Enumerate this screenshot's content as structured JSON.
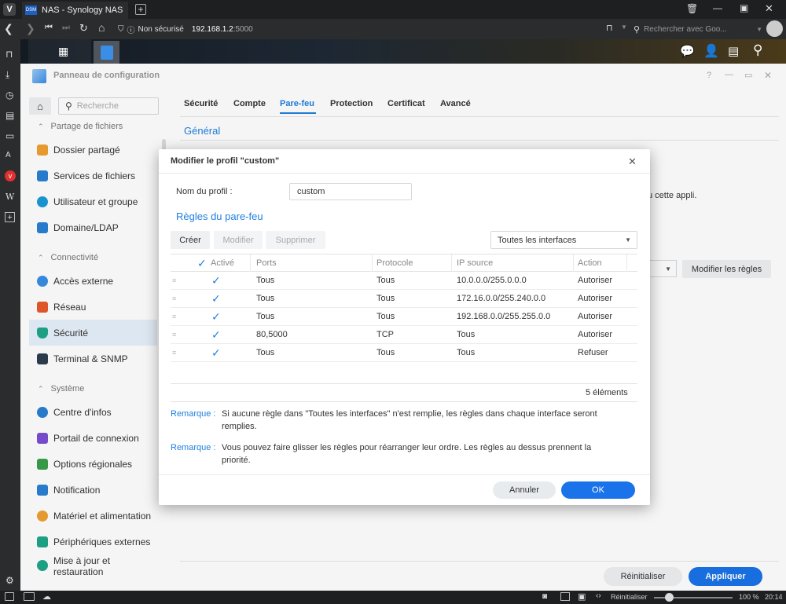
{
  "browser": {
    "tab_title": "NAS - Synology NAS",
    "security_label": "Non sécurisé",
    "url_host": "192.168.1.2",
    "url_port": ":5000",
    "search_placeholder": "Rechercher avec Goo..."
  },
  "window": {
    "title": "Panneau de configuration",
    "controls": [
      "?",
      "—",
      "▭",
      "✕"
    ]
  },
  "sidebar": {
    "search_placeholder": "Recherche",
    "sections": {
      "file_sharing": "Partage de fichiers",
      "connectivity": "Connectivité",
      "system": "Système"
    },
    "items": [
      {
        "label": "Dossier partagé",
        "icon": "folder-icon",
        "color": "#f0a030"
      },
      {
        "label": "Services de fichiers",
        "icon": "file-services-icon",
        "color": "#2a7fd4"
      },
      {
        "label": "Utilisateur et groupe",
        "icon": "users-icon",
        "color": "#1a9ad6"
      },
      {
        "label": "Domaine/LDAP",
        "icon": "domain-icon",
        "color": "#2a7fd4"
      },
      {
        "label": "Accès externe",
        "icon": "external-access-icon",
        "color": "#3a8ee6"
      },
      {
        "label": "Réseau",
        "icon": "network-icon",
        "color": "#e55a2b"
      },
      {
        "label": "Sécurité",
        "icon": "shield-icon",
        "color": "#1fa68a"
      },
      {
        "label": "Terminal & SNMP",
        "icon": "terminal-icon",
        "color": "#2d3e50"
      },
      {
        "label": "Centre d'infos",
        "icon": "info-icon",
        "color": "#2a7fd4"
      },
      {
        "label": "Portail de connexion",
        "icon": "portal-icon",
        "color": "#7a4fd4"
      },
      {
        "label": "Options régionales",
        "icon": "regional-icon",
        "color": "#3aa04a"
      },
      {
        "label": "Notification",
        "icon": "notification-icon",
        "color": "#2a7fd4"
      },
      {
        "label": "Matériel et alimentation",
        "icon": "bulb-icon",
        "color": "#f0a030"
      },
      {
        "label": "Périphériques externes",
        "icon": "external-devices-icon",
        "color": "#1fa68a"
      },
      {
        "label": "Mise à jour et",
        "label2": "restauration",
        "icon": "update-icon",
        "color": "#1fa68a"
      }
    ]
  },
  "tabs": [
    "Sécurité",
    "Compte",
    "Pare-feu",
    "Protection",
    "Certificat",
    "Avancé"
  ],
  "content": {
    "section_title": "Général",
    "partial_text": "u cette appli.",
    "edit_rules_button": "Modifier les règles",
    "reset_button": "Réinitialiser",
    "apply_button": "Appliquer"
  },
  "dialog": {
    "title": "Modifier le profil \"custom\"",
    "profile_label": "Nom du profil :",
    "profile_value": "custom",
    "rules_title": "Règles du pare-feu",
    "toolbar": {
      "create": "Créer",
      "modify": "Modifier",
      "delete": "Supprimer",
      "interface_select": "Toutes les interfaces"
    },
    "columns": [
      "Activé",
      "Ports",
      "Protocole",
      "IP source",
      "Action"
    ],
    "rows": [
      {
        "ports": "Tous",
        "protocol": "Tous",
        "source": "10.0.0.0/255.0.0.0",
        "action": "Autoriser"
      },
      {
        "ports": "Tous",
        "protocol": "Tous",
        "source": "172.16.0.0/255.240.0.0",
        "action": "Autoriser"
      },
      {
        "ports": "Tous",
        "protocol": "Tous",
        "source": "192.168.0.0/255.255.0.0",
        "action": "Autoriser"
      },
      {
        "ports": "80,5000",
        "protocol": "TCP",
        "source": "Tous",
        "action": "Autoriser"
      },
      {
        "ports": "Tous",
        "protocol": "Tous",
        "source": "Tous",
        "action": "Refuser"
      }
    ],
    "count": "5 éléments",
    "note_label": "Remarque :",
    "note1_line1": "Si aucune règle dans \"Toutes les interfaces\" n'est remplie, les règles dans chaque interface seront",
    "note1_line2": "remplies.",
    "note2_line1": "Vous pouvez faire glisser les règles pour réarranger leur ordre. Les règles au dessus prennent la",
    "note2_line2": "priorité.",
    "cancel": "Annuler",
    "ok": "OK"
  },
  "statusbar": {
    "reset": "Réinitialiser",
    "zoom": "100 %",
    "time": "20:14"
  },
  "colors": {
    "accent": "#1f7fe0",
    "primary_button": "#1a73e8",
    "selected_bg": "#e6f1fb"
  }
}
